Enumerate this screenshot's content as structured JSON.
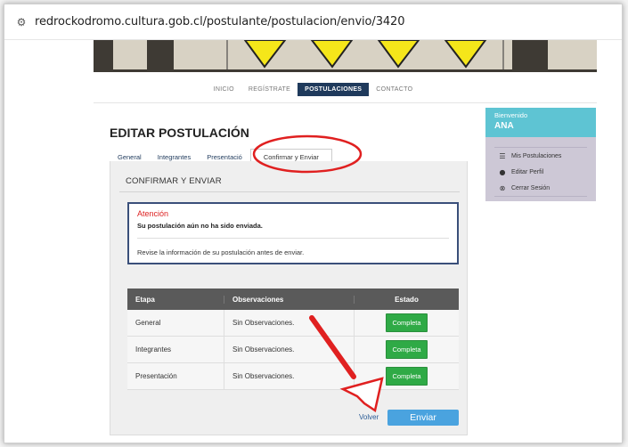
{
  "browser": {
    "url": "redrockodromo.cultura.gob.cl/postulante/postulacion/envio/3420",
    "site_icon": "tune-icon"
  },
  "nav": {
    "items": [
      "INICIO",
      "REGÍSTRATE",
      "POSTULACIONES",
      "CONTACTO"
    ],
    "active": "POSTULACIONES"
  },
  "page": {
    "title": "EDITAR POSTULACIÓN",
    "tabs": [
      "General",
      "Integrantes",
      "Presentació",
      "Confirmar y Enviar"
    ],
    "active_tab": "Confirmar y Enviar"
  },
  "confirm": {
    "section_title": "CONFIRMAR Y ENVIAR",
    "alert_title": "Atención",
    "alert_message": "Su postulación aún no ha sido enviada.",
    "alert_note": "Revise la información de su postulación antes de enviar."
  },
  "table": {
    "headers": [
      "Etapa",
      "Observaciones",
      "Estado"
    ],
    "rows": [
      {
        "etapa": "General",
        "observaciones": "Sin Observaciones.",
        "estado": "Completa"
      },
      {
        "etapa": "Integrantes",
        "observaciones": "Sin Observaciones.",
        "estado": "Completa"
      },
      {
        "etapa": "Presentación",
        "observaciones": "Sin Observaciones.",
        "estado": "Completa"
      }
    ]
  },
  "actions": {
    "back": "Volver",
    "submit": "Enviar"
  },
  "sidebar": {
    "welcome_label": "Bienvenido",
    "user_name": "ANA",
    "menu": [
      {
        "label": "Mis Postulaciones",
        "icon": "list-icon"
      },
      {
        "label": "Editar Perfil",
        "icon": "user-circle-icon"
      },
      {
        "label": "Cerrar Sesión",
        "icon": "close-circle-icon"
      }
    ]
  },
  "colors": {
    "nav_active": "#1f3a5c",
    "alert_title": "#dd2222",
    "badge": "#2faa46",
    "submit": "#4aa3df",
    "welcome": "#5ec4d3",
    "annotation": "#e02020"
  }
}
